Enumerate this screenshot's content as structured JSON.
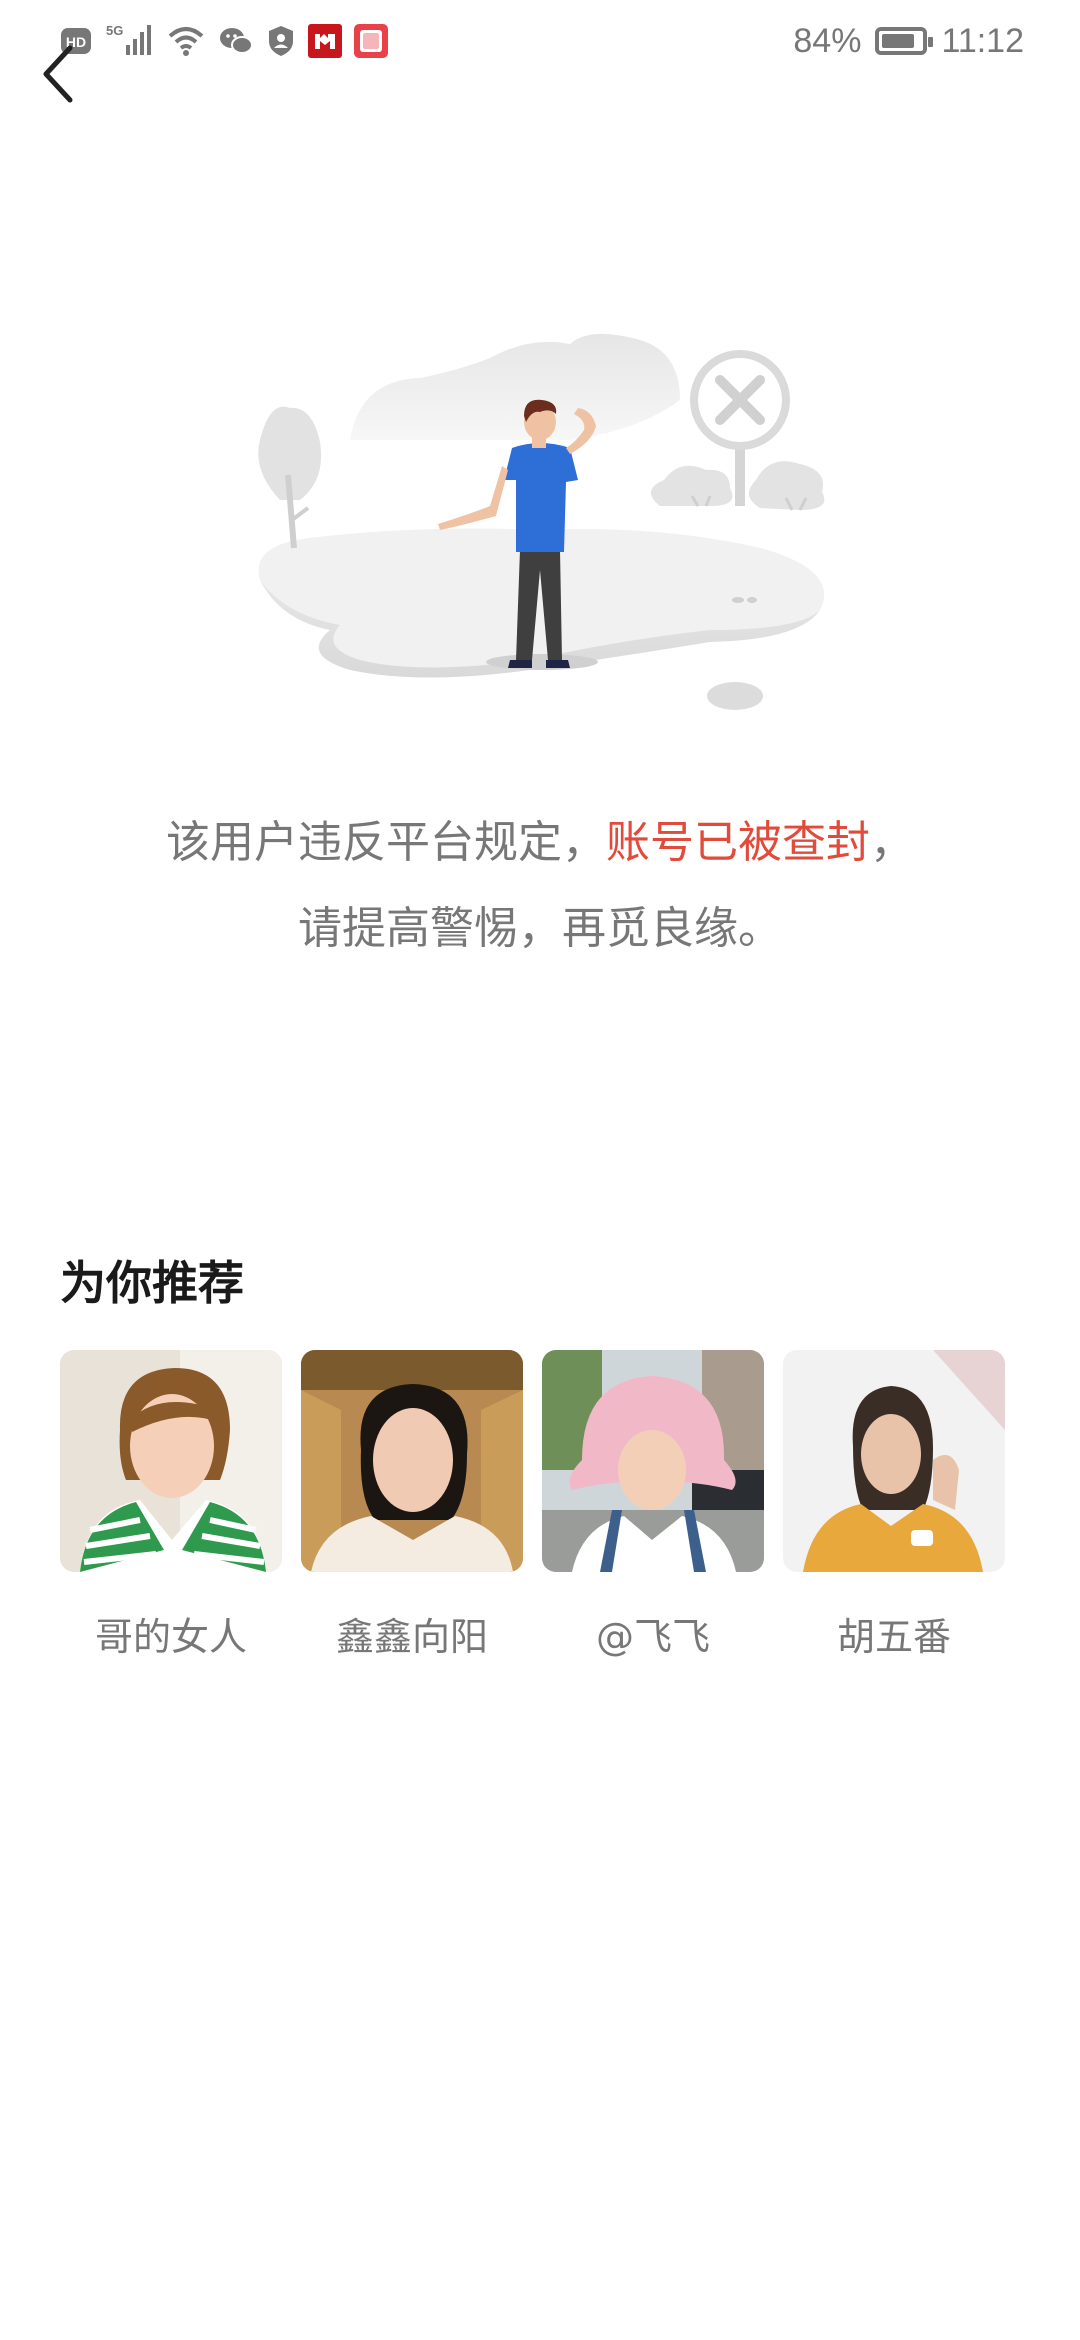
{
  "status_bar": {
    "network_badge": "HD",
    "network_type": "5G",
    "battery_percent": "84%",
    "battery_level": 0.84,
    "time": "11:12",
    "icons": [
      "hd-icon",
      "signal-icon",
      "wifi-icon",
      "wechat-icon",
      "shield-icon",
      "app-icon",
      "note-icon",
      "battery-icon"
    ]
  },
  "nav": {
    "back_icon": "chevron-left-icon"
  },
  "notice": {
    "line1_prefix": "该用户违反平台规定，",
    "line1_highlight": "账号已被查封",
    "line1_suffix": "，",
    "line2": "请提高警惕，再觅良缘。",
    "highlight_color": "#e24b3b"
  },
  "recommendations": {
    "title": "为你推荐",
    "items": [
      {
        "name": "哥的女人"
      },
      {
        "name": "鑫鑫向阳"
      },
      {
        "name": "@飞飞"
      },
      {
        "name": "胡五番"
      }
    ]
  }
}
